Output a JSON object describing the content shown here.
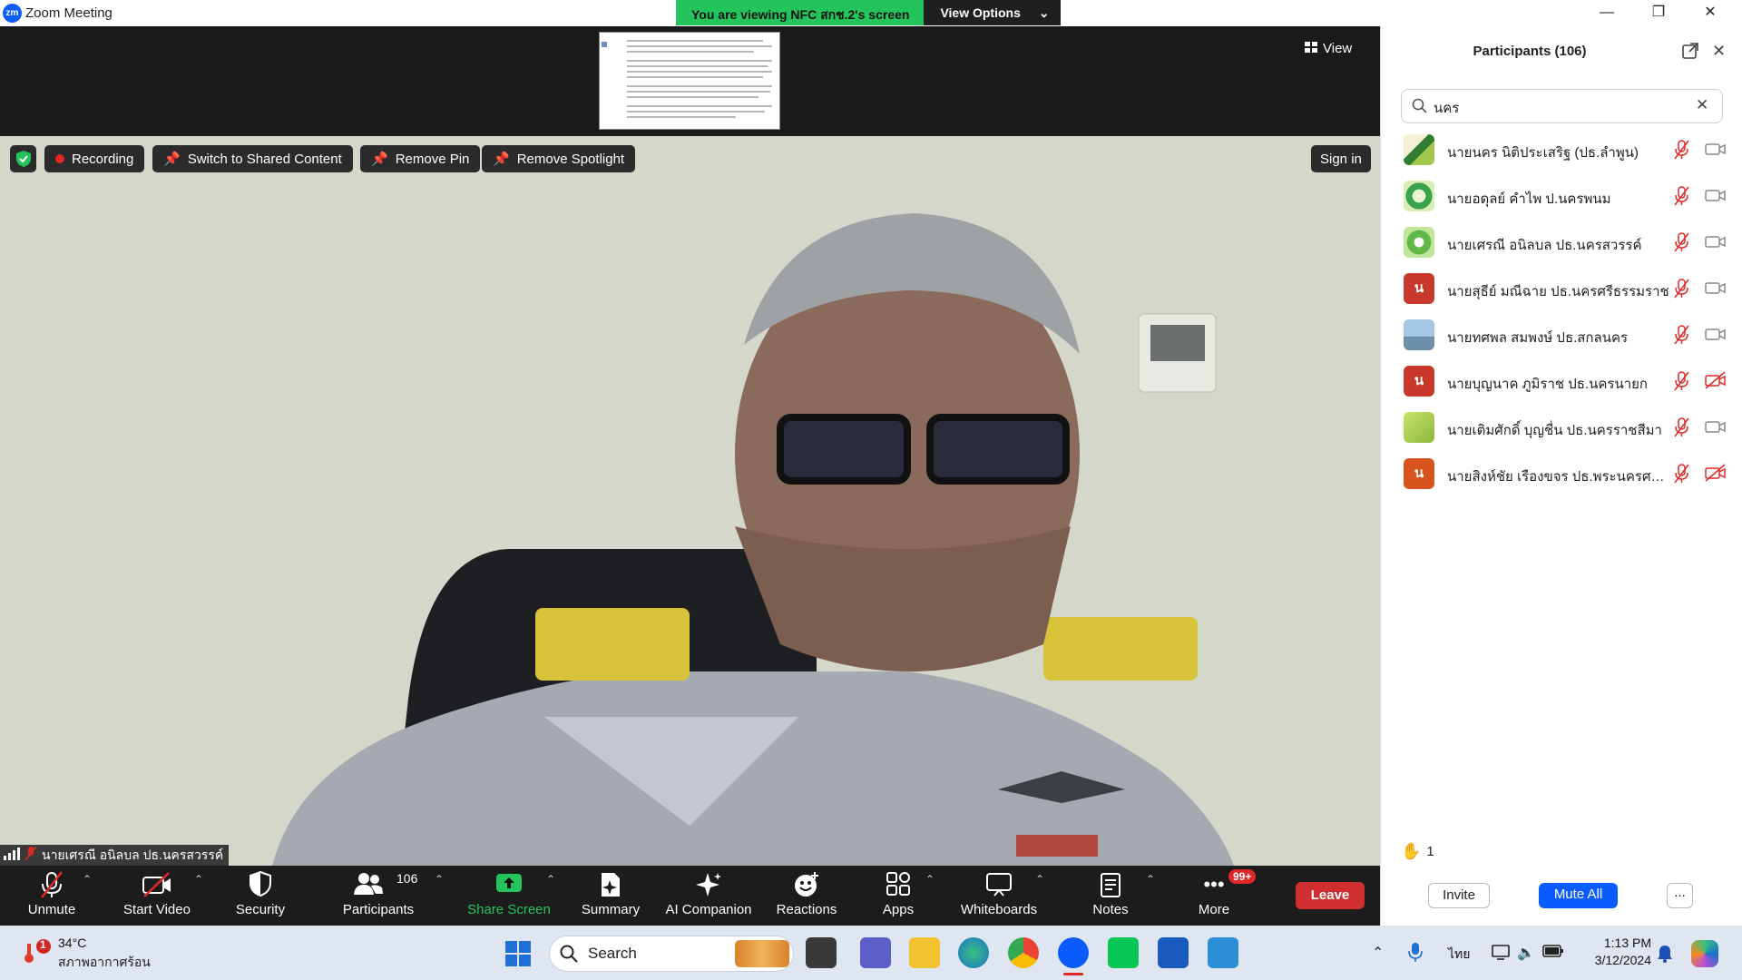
{
  "window": {
    "title": "Zoom Meeting",
    "logo_text": "zm",
    "controls": [
      "minimize",
      "restore",
      "close"
    ]
  },
  "share_banner": {
    "text": "You are viewing NFC สกช.2's screen",
    "view_options": "View Options",
    "colors": {
      "banner": "#23c45b",
      "options": "#1f1f1f"
    }
  },
  "view_button": "View",
  "video_controls": {
    "recording": "Recording",
    "switch_shared": "Switch to Shared Content",
    "remove_pin": "Remove Pin",
    "remove_spotlight": "Remove Spotlight",
    "sign_in": "Sign in"
  },
  "active_speaker": {
    "name": "นายเศรณี อนิลบล ปธ.นครสวรรค์"
  },
  "toolbar": {
    "unmute": "Unmute",
    "start_video": "Start Video",
    "security": "Security",
    "participants": "Participants",
    "participants_count": "106",
    "share_screen": "Share Screen",
    "summary": "Summary",
    "ai_companion": "AI Companion",
    "reactions": "Reactions",
    "apps": "Apps",
    "whiteboards": "Whiteboards",
    "notes": "Notes",
    "more": "More",
    "more_badge": "99+",
    "leave": "Leave",
    "colors": {
      "leave": "#d12f2f",
      "share": "#23c45b"
    }
  },
  "participants_panel": {
    "title": "Participants (106)",
    "search_value": "นคร",
    "participants": [
      {
        "name": "นายนคร นิติประเสริฐ (ปธ.ลำพูน)",
        "avatar": "leaf",
        "muted": true,
        "video_off": false
      },
      {
        "name": "นายอดุลย์ คำไพ ป.นครพนม",
        "avatar": "emblem",
        "muted": true,
        "video_off": false
      },
      {
        "name": "นายเศรณี อนิลบล ปธ.นครสวรรค์",
        "avatar": "emblem2",
        "muted": true,
        "video_off": false
      },
      {
        "name": "นายสุธีย์  มณีฉาย ปธ.นครศรีธรรมราช",
        "avatar": "letter",
        "letter": "น",
        "muted": true,
        "video_off": false
      },
      {
        "name": "นายทศพล  สมพงษ์ ปธ.สกลนคร",
        "avatar": "lake",
        "muted": true,
        "video_off": false
      },
      {
        "name": "นายบุญนาค  ภูมิราช ปธ.นครนายก",
        "avatar": "letter",
        "letter": "น",
        "muted": true,
        "video_off": true
      },
      {
        "name": "นายเติมศักดิ์ บุญชื่น ปธ.นครราชสีมา",
        "avatar": "green2",
        "muted": true,
        "video_off": false
      },
      {
        "name": "นายสิงห์ชัย เรืองขจร ปธ.พระนครศรีอยุธ...",
        "avatar": "letter-orange",
        "letter": "น",
        "muted": true,
        "video_off": true
      }
    ],
    "raised_hands": "1",
    "invite": "Invite",
    "mute_all": "Mute All",
    "more": "...",
    "colors": {
      "mute_all": "#0b5cff"
    }
  },
  "taskbar": {
    "weather_temp": "34°C",
    "weather_desc": "สภาพอากาศร้อน",
    "weather_badge": "1",
    "search_label": "Search",
    "language": "ไทย",
    "time": "1:13 PM",
    "date": "3/12/2024",
    "apps": [
      "start",
      "search",
      "task-view",
      "teams",
      "file-explorer",
      "edge",
      "chrome",
      "zoom",
      "line",
      "word",
      "notepad"
    ]
  }
}
